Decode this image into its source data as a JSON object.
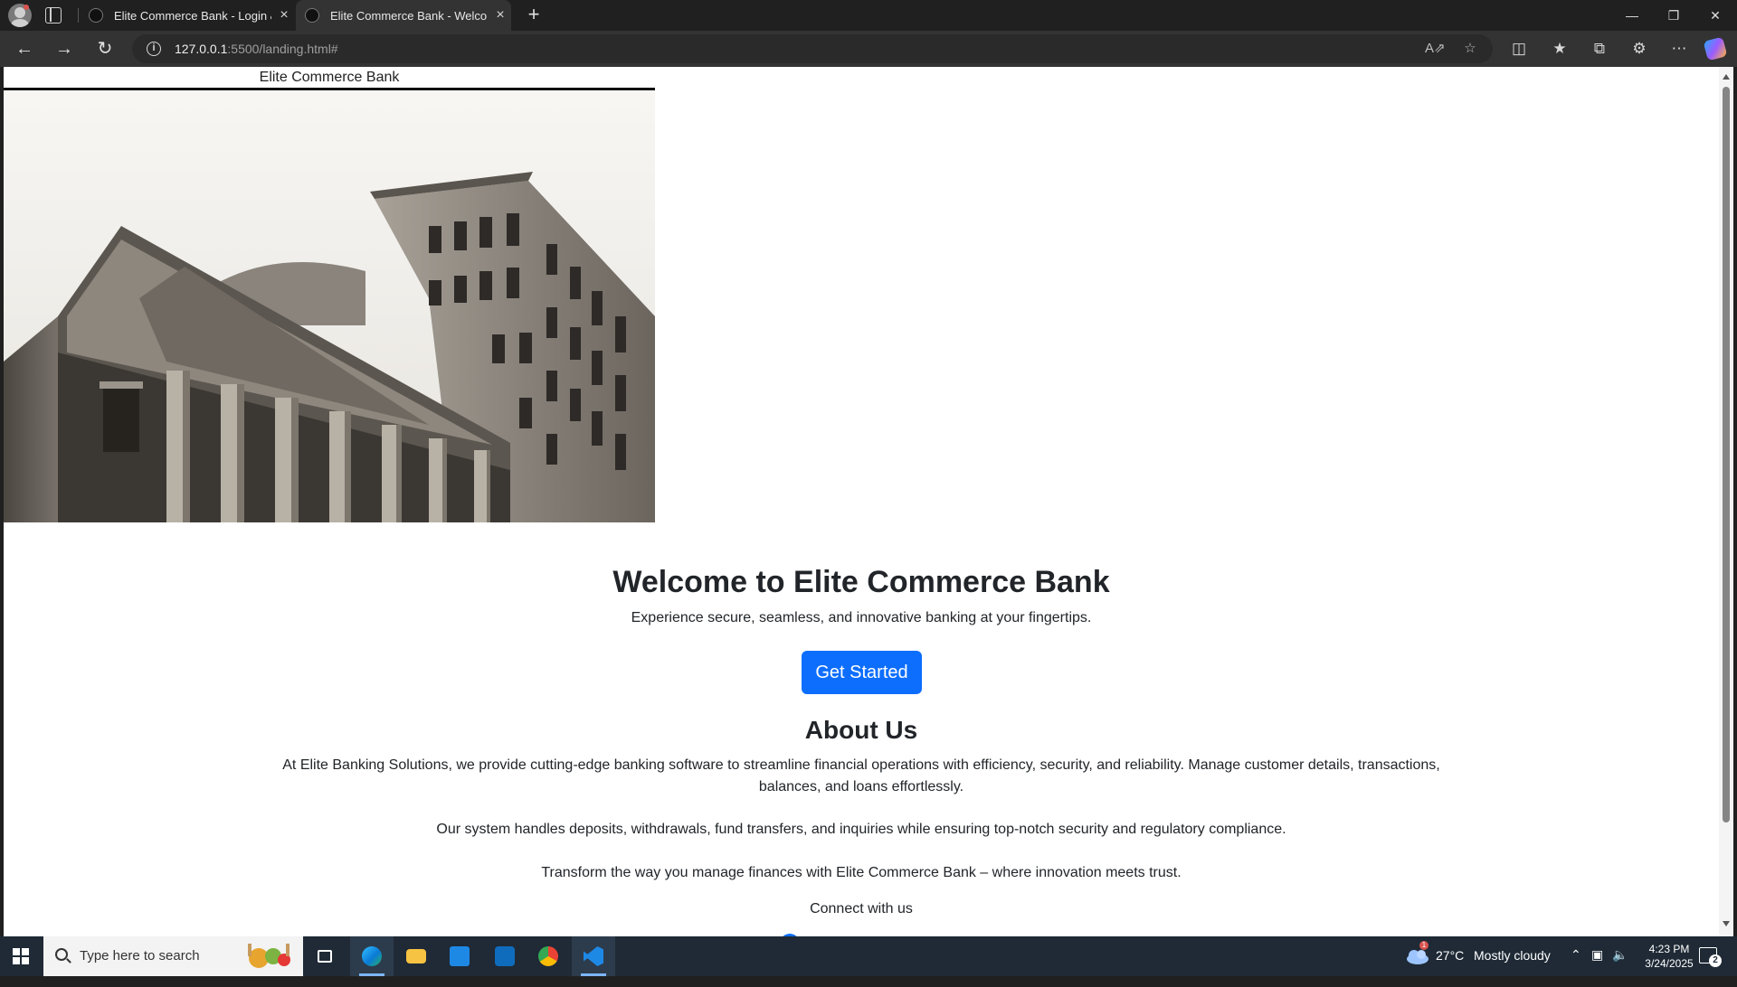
{
  "browser": {
    "tabs": [
      {
        "title": "Elite Commerce Bank - Login & Si",
        "active": false
      },
      {
        "title": "Elite Commerce Bank - Welcome",
        "active": true
      }
    ],
    "url_host": "127.0.0.1",
    "url_path": ":5500/landing.html#"
  },
  "page": {
    "brand": "Elite Commerce Bank",
    "hero_alt": "Classical bank building",
    "welcome_title": "Welcome to Elite Commerce Bank",
    "tagline": "Experience secure, seamless, and innovative banking at your fingertips.",
    "cta_label": "Get Started",
    "about": {
      "title": "About Us",
      "p1": "At Elite Banking Solutions, we provide cutting-edge banking software to streamline financial operations with efficiency, security, and reliability. Manage customer details, transactions, balances, and loans effortlessly.",
      "p2": "Our system handles deposits, withdrawals, fund transfers, and inquiries while ensuring top-notch security and regulatory compliance.",
      "p3": "Transform the way you manage finances with Elite Commerce Bank – where innovation meets trust."
    },
    "connect_label": "Connect with us",
    "colors": {
      "primary": "#0d6efd",
      "text": "#212529"
    }
  },
  "taskbar": {
    "search_placeholder": "Type here to search",
    "weather_temp": "27°C",
    "weather_desc": "Mostly cloudy",
    "weather_badge": "1",
    "time": "4:23 PM",
    "date": "3/24/2025",
    "notification_count": "2"
  }
}
